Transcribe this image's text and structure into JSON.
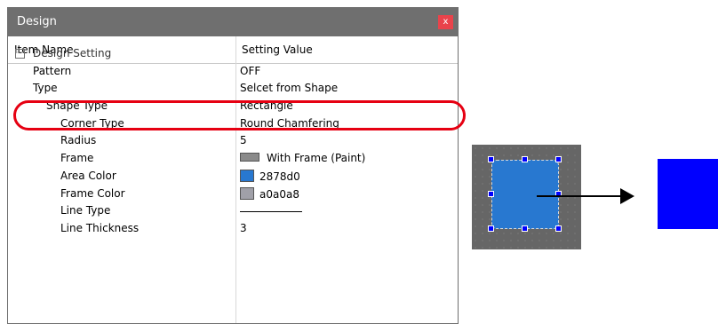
{
  "panel": {
    "title": "Design",
    "close_glyph": "x",
    "columns": {
      "item_name": "Item Name",
      "setting_value": "Setting Value"
    },
    "group": {
      "expander_glyph": "⊟",
      "label": "Design Setting"
    },
    "rows": [
      {
        "name": "Pattern",
        "value": "OFF"
      },
      {
        "name": "Type",
        "value": "Selcet from Shape"
      },
      {
        "name": "Shape Type",
        "value": "Rectangle"
      },
      {
        "name": "Corner Type",
        "value": "Round Chamfering"
      },
      {
        "name": "Radius",
        "value": "5"
      },
      {
        "name": "Frame",
        "value": "With Frame (Paint)"
      },
      {
        "name": "Area Color",
        "value": "2878d0"
      },
      {
        "name": "Frame Color",
        "value": "a0a0a8"
      },
      {
        "name": "Line Type",
        "value": ""
      },
      {
        "name": "Line Thickness",
        "value": "3"
      }
    ]
  },
  "colors": {
    "area_color": "#2878d0",
    "frame_color": "#a0a0a8",
    "result_color": "#0000ff",
    "highlight": "#e60012"
  },
  "icons": {
    "close": "close-icon",
    "expander": "collapse-icon",
    "arrow": "right-arrow-icon"
  }
}
